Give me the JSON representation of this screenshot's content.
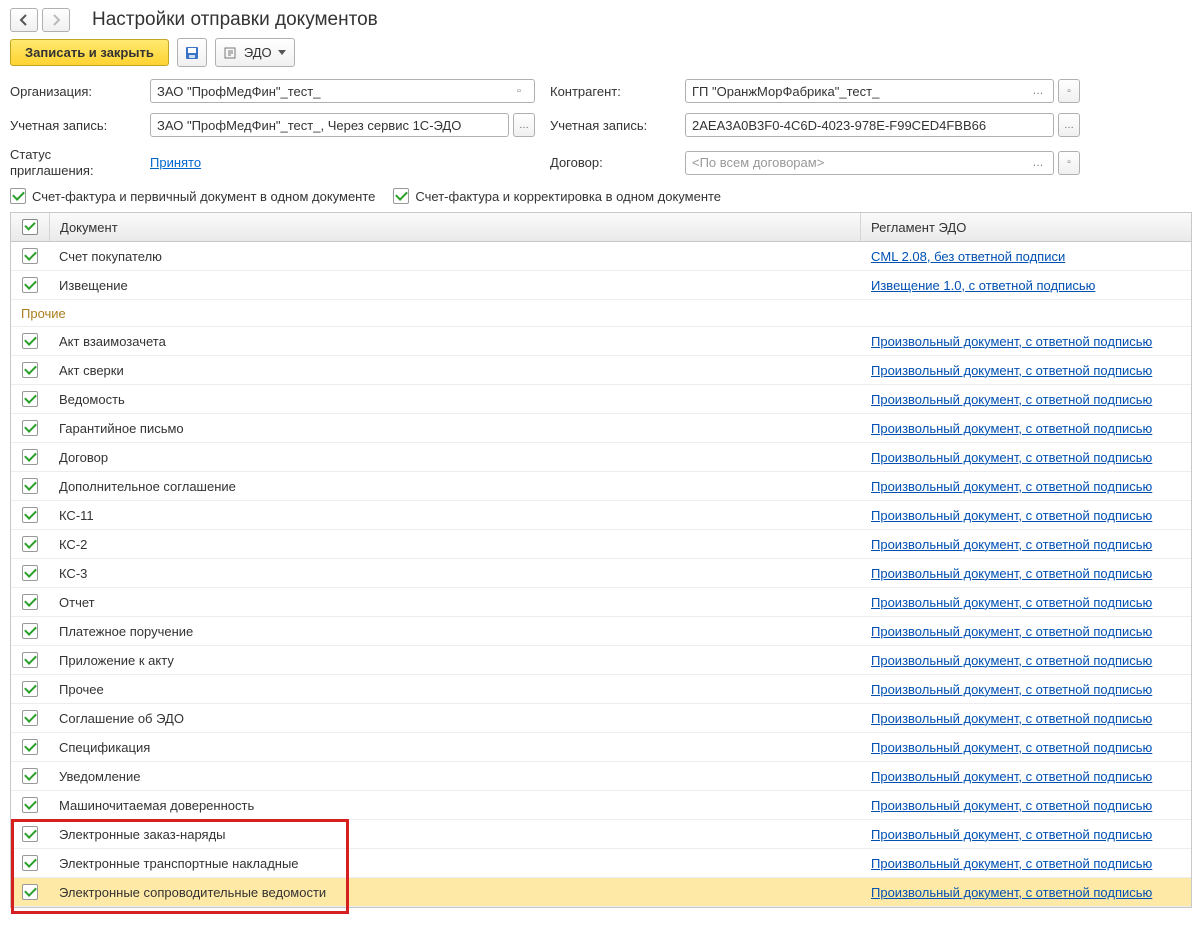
{
  "title": "Настройки отправки документов",
  "toolbar": {
    "save_close": "Записать и закрыть",
    "edo": "ЭДО"
  },
  "fields": {
    "org_label": "Организация:",
    "org_value": "ЗАО \"ПрофМедФин\"_тест_",
    "counterparty_label": "Контрагент:",
    "counterparty_value": "ГП \"ОранжМорФабрика\"_тест_",
    "account_label": "Учетная запись:",
    "account_value": "ЗАО \"ПрофМедФин\"_тест_, Через сервис 1С-ЭДО",
    "account2_label": "Учетная запись:",
    "account2_value": "2AEA3A0B3F0-4C6D-4023-978E-F99CED4FBB66",
    "status_label": "Статус приглашения:",
    "status_value": "Принято",
    "contract_label": "Договор:",
    "contract_placeholder": "<По всем договорам>"
  },
  "checkboxes": {
    "c1": "Счет-фактура и первичный документ в одном документе",
    "c2": "Счет-фактура и корректировка в одном документе"
  },
  "columns": {
    "doc": "Документ",
    "reg": "Регламент ЭДО"
  },
  "group_other": "Прочие",
  "arbitrary_link": "Произвольный документ, с ответной подписью",
  "top_rows": [
    {
      "doc": "Счет покупателю",
      "reg": "CML 2.08, без ответной подписи"
    },
    {
      "doc": "Извещение",
      "reg": "Извещение 1.0, с ответной подписью"
    }
  ],
  "other_rows": [
    "Акт взаимозачета",
    "Акт сверки",
    "Ведомость",
    "Гарантийное письмо",
    "Договор",
    "Дополнительное соглашение",
    "КС-11",
    "КС-2",
    "КС-3",
    "Отчет",
    "Платежное поручение",
    "Приложение к акту",
    "Прочее",
    "Соглашение об ЭДО",
    "Спецификация",
    "Уведомление",
    "Машиночитаемая доверенность",
    "Электронные заказ-наряды",
    "Электронные транспортные накладные",
    "Электронные сопроводительные ведомости"
  ]
}
